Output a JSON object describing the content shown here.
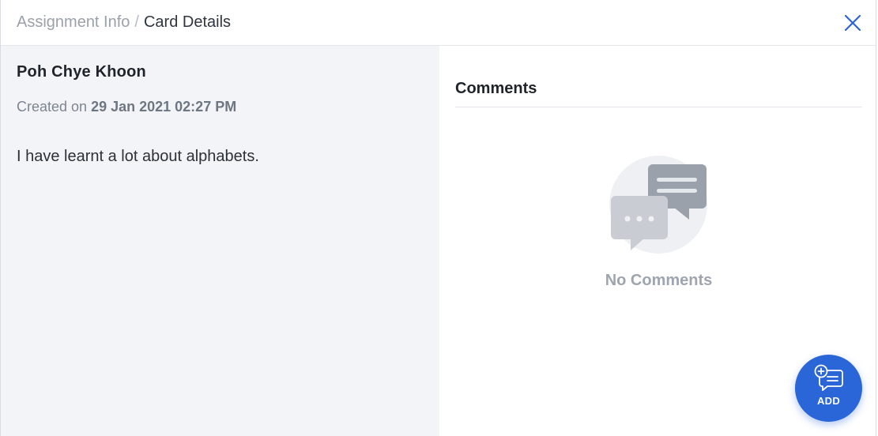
{
  "header": {
    "breadcrumb_parent": "Assignment Info",
    "breadcrumb_separator": "/",
    "breadcrumb_current": "Card Details",
    "close_icon": "close-icon"
  },
  "card": {
    "author": "Poh Chye Khoon",
    "created_prefix": "Created on",
    "created_date": "29 Jan 2021 02:27 PM",
    "body": "I have learnt a lot about alphabets."
  },
  "comments": {
    "title": "Comments",
    "empty_icon": "chat-bubbles-icon",
    "empty_text": "No Comments"
  },
  "add_button": {
    "label": "ADD",
    "icon": "add-comment-icon"
  },
  "colors": {
    "accent": "#2a66d8",
    "left_pane_bg": "#f2f4f8"
  }
}
